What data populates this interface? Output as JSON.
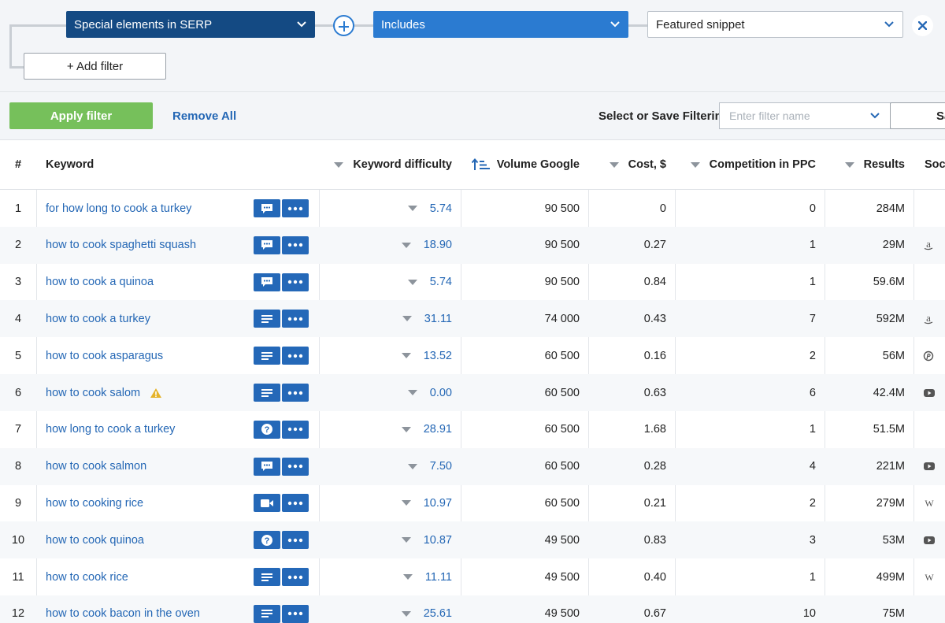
{
  "filters": {
    "field": "Special elements in SERP",
    "operator": "Includes",
    "value": "Featured snippet",
    "add_filter_label": "+ Add filter"
  },
  "actions": {
    "apply_label": "Apply filter",
    "remove_all_label": "Remove All",
    "save_filtering_label": "Select or Save Filtering:",
    "filter_name_placeholder": "Enter filter name",
    "save_label": "Sa"
  },
  "table": {
    "headers": {
      "num": "#",
      "keyword": "Keyword",
      "difficulty": "Keyword difficulty",
      "volume": "Volume Google",
      "cost": "Cost, $",
      "competition": "Competition in PPC",
      "results": "Results",
      "social": "Soci"
    },
    "rows": [
      {
        "num": "1",
        "keyword": "for how long to cook a turkey",
        "badge": "chat-icon",
        "difficulty": "5.74",
        "volume": "90 500",
        "cost": "0",
        "competition": "0",
        "results": "284M",
        "social": ""
      },
      {
        "num": "2",
        "keyword": "how to cook spaghetti squash",
        "badge": "chat-icon",
        "difficulty": "18.90",
        "volume": "90 500",
        "cost": "0.27",
        "competition": "1",
        "results": "29M",
        "social": "amazon-icon"
      },
      {
        "num": "3",
        "keyword": "how to cook a quinoa",
        "badge": "chat-icon",
        "difficulty": "5.74",
        "volume": "90 500",
        "cost": "0.84",
        "competition": "1",
        "results": "59.6M",
        "social": ""
      },
      {
        "num": "4",
        "keyword": "how to cook a turkey",
        "badge": "list-icon",
        "difficulty": "31.11",
        "volume": "74 000",
        "cost": "0.43",
        "competition": "7",
        "results": "592M",
        "social": "amazon-icon"
      },
      {
        "num": "5",
        "keyword": "how to cook asparagus",
        "badge": "list-icon",
        "difficulty": "13.52",
        "volume": "60 500",
        "cost": "0.16",
        "competition": "2",
        "results": "56M",
        "social": "pinterest-icon"
      },
      {
        "num": "6",
        "keyword": "how to cook salom",
        "badge": "list-icon",
        "difficulty": "0.00",
        "volume": "60 500",
        "cost": "0.63",
        "competition": "6",
        "results": "42.4M",
        "social": "youtube-icon",
        "warning": true
      },
      {
        "num": "7",
        "keyword": "how long to cook a turkey",
        "badge": "question-icon",
        "difficulty": "28.91",
        "volume": "60 500",
        "cost": "1.68",
        "competition": "1",
        "results": "51.5M",
        "social": ""
      },
      {
        "num": "8",
        "keyword": "how to cook salmon",
        "badge": "chat-icon",
        "difficulty": "7.50",
        "volume": "60 500",
        "cost": "0.28",
        "competition": "4",
        "results": "221M",
        "social": "youtube-icon"
      },
      {
        "num": "9",
        "keyword": "how to cooking rice",
        "badge": "video-icon",
        "difficulty": "10.97",
        "volume": "60 500",
        "cost": "0.21",
        "competition": "2",
        "results": "279M",
        "social": "wikipedia-icon"
      },
      {
        "num": "10",
        "keyword": "how to cook quinoa",
        "badge": "question-icon",
        "difficulty": "10.87",
        "volume": "49 500",
        "cost": "0.83",
        "competition": "3",
        "results": "53M",
        "social": "youtube-icon"
      },
      {
        "num": "11",
        "keyword": "how to cook rice",
        "badge": "list-icon",
        "difficulty": "11.11",
        "volume": "49 500",
        "cost": "0.40",
        "competition": "1",
        "results": "499M",
        "social": "wikipedia-icon"
      },
      {
        "num": "12",
        "keyword": "how to cook bacon in the oven",
        "badge": "list-icon",
        "difficulty": "25.61",
        "volume": "49 500",
        "cost": "0.67",
        "competition": "10",
        "results": "75M",
        "social": ""
      }
    ]
  },
  "colors": {
    "dark_blue": "#144a83",
    "blue": "#2b7bd1",
    "badge_blue": "#2468b8",
    "link_blue": "#2467b5",
    "green": "#76c05b",
    "warning": "#e5b32a"
  }
}
